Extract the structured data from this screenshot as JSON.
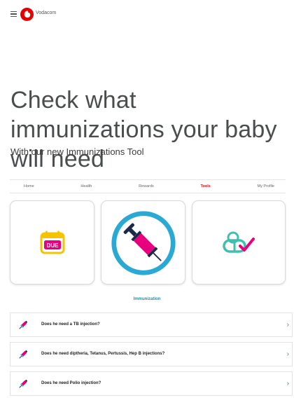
{
  "header": {
    "brand": "Vodacom",
    "brand_color": "#e60000",
    "menu_icon": "hamburger-icon"
  },
  "hero": {
    "title": "Check what immunizations your baby will need",
    "subtitle": "With our new Immunizations Tool"
  },
  "nav": {
    "tabs": [
      {
        "label": "Home"
      },
      {
        "label": "Health"
      },
      {
        "label": "Rewards"
      },
      {
        "label": "Tools",
        "active": true
      },
      {
        "label": "My Profile"
      }
    ],
    "active_color": "#e60000"
  },
  "tools": {
    "cards": [
      {
        "icon": "due-calendar-icon",
        "badge_text": "DUE",
        "color": "#f5c400"
      },
      {
        "icon": "syringe-icon",
        "color": "#29a9d4",
        "selected": true
      },
      {
        "icon": "pill-check-icon",
        "color": "#3fbfae"
      }
    ],
    "selected_label": "Immunization"
  },
  "questions": [
    {
      "text": "Does he need a TB injection?",
      "icon": "syringe-small-icon"
    },
    {
      "text": "Does he need diptheria, Tetanus, Pertussis, Hep B injections?",
      "icon": "syringe-small-icon"
    },
    {
      "text": "Does he need Polio injection?",
      "icon": "syringe-small-icon"
    }
  ],
  "chevron_glyph": "›"
}
